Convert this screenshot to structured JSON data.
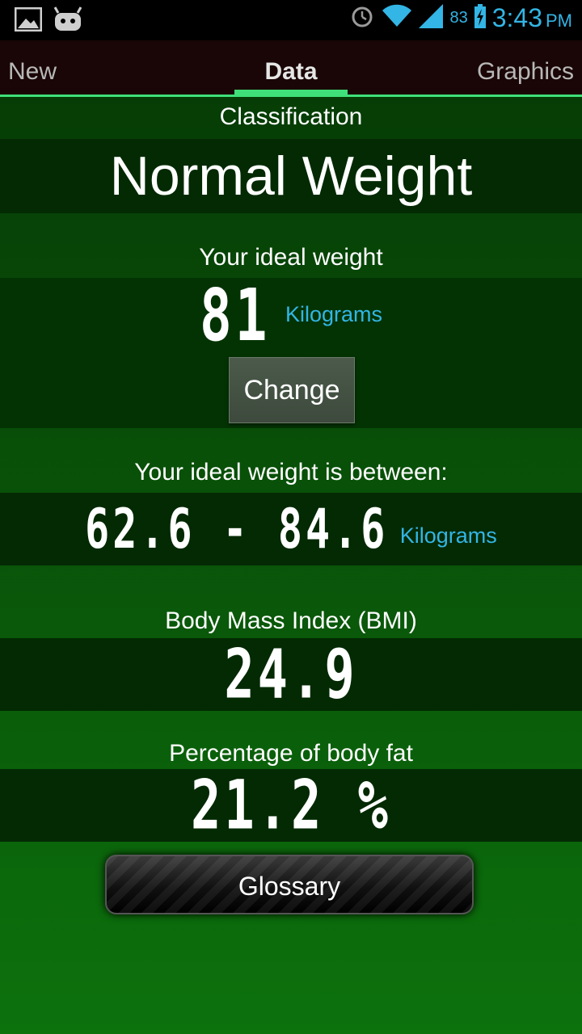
{
  "status_bar": {
    "battery": "83",
    "time": "3:43",
    "ampm": "PM"
  },
  "tabs": [
    {
      "label": "New"
    },
    {
      "label": "Data"
    },
    {
      "label": "Graphics"
    }
  ],
  "classification": {
    "label": "Classification",
    "value": "Normal Weight"
  },
  "ideal_weight": {
    "label": "Your ideal weight",
    "value": "81",
    "unit": "Kilograms",
    "change_label": "Change"
  },
  "ideal_range": {
    "label": "Your ideal weight is between:",
    "value": "62.6 - 84.6",
    "unit": "Kilograms"
  },
  "bmi": {
    "label": "Body Mass Index (BMI)",
    "value": "24.9"
  },
  "body_fat": {
    "label": "Percentage of body fat",
    "value": "21.2 %"
  },
  "glossary_label": "Glossary",
  "colors": {
    "accent": "#33b5e5",
    "tab_indicator": "#3fe07a"
  }
}
